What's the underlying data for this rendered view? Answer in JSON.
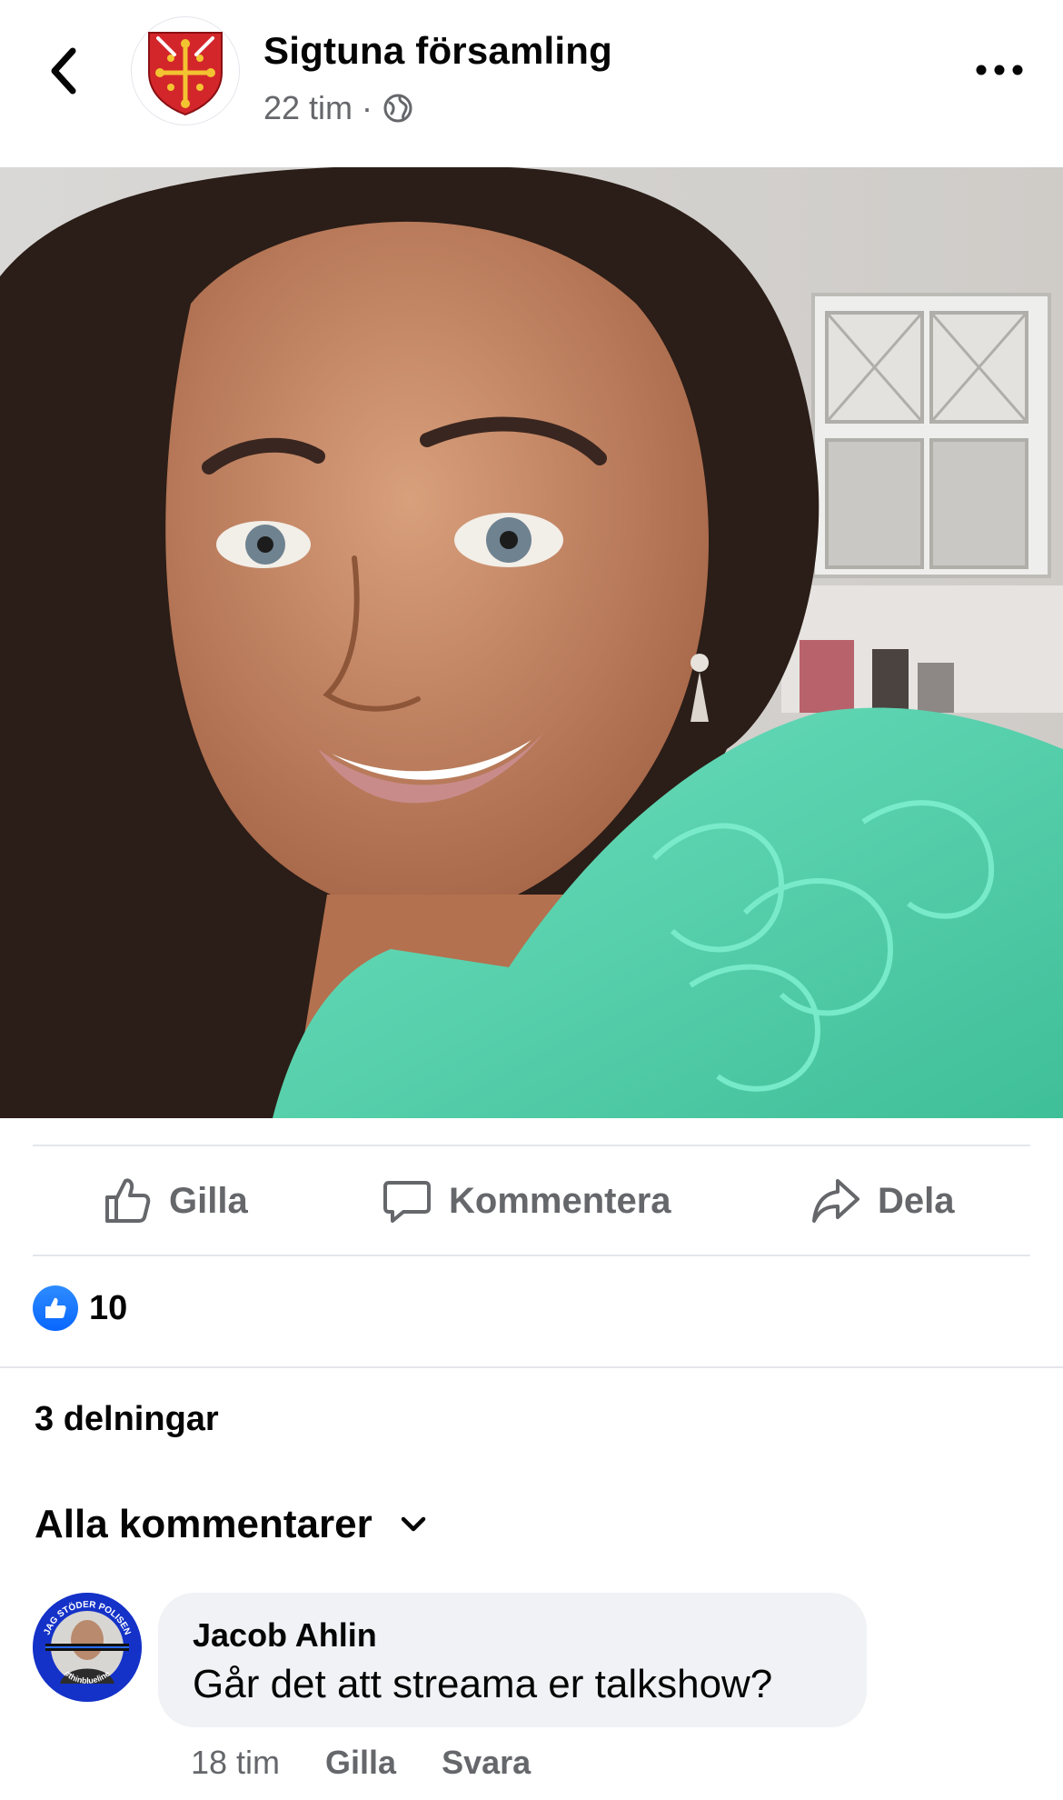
{
  "header": {
    "page_name": "Sigtuna församling",
    "time": "22 tim",
    "separator": "·",
    "audience_icon": "globe-icon",
    "back_icon": "chevron-left-icon",
    "more_icon": "more-dots-icon"
  },
  "post": {
    "photo_icon": "photo-portrait"
  },
  "actions": {
    "like_label": "Gilla",
    "comment_label": "Kommentera",
    "share_label": "Dela"
  },
  "stats": {
    "like_count": "10",
    "shares": "3 delningar"
  },
  "comments": {
    "filter_label": "Alla kommentarer",
    "items": [
      {
        "author": "Jacob Ahlin",
        "text": "Går det att streama er talkshow?",
        "time": "18 tim",
        "like": "Gilla",
        "reply": "Svara",
        "avatar_badge": "JAG STÖDER POLISEN",
        "avatar_tag": "#thinblueline"
      }
    ]
  },
  "colors": {
    "accent": "#0866ff",
    "muted": "#65676b",
    "divider": "#e4e6eb",
    "bubble": "#f0f2f5",
    "shirt": "#5fd6b2"
  }
}
